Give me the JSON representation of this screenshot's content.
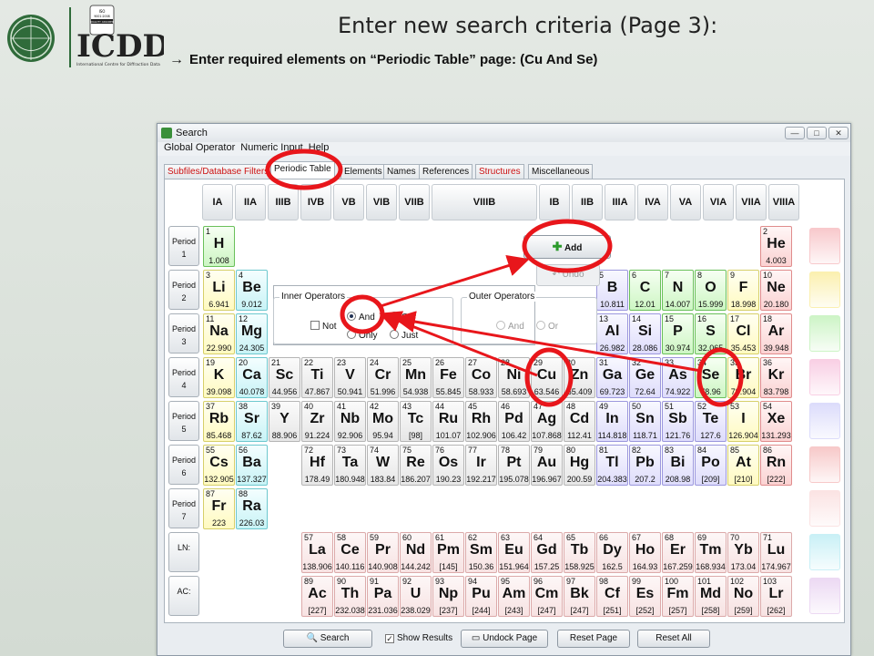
{
  "slide": {
    "title": "Enter new search criteria (Page 3):",
    "subtitle": "Enter required elements on “Periodic Table” page: (Cu And Se)",
    "bullet": "→",
    "logo_text": "ICDD",
    "logo_sub": "International Centre for Diffraction Data",
    "logo_badge": "ISO 9001:2008 QUALITY ASSURED COMPANY"
  },
  "window": {
    "title": "Search",
    "menu": [
      "Global Operator",
      "Numeric Input",
      "Help"
    ],
    "tabs": [
      {
        "label": "Subfiles/Database Filters",
        "red": true
      },
      {
        "label": "Periodic Table",
        "selected": true
      },
      {
        "label": "Elements"
      },
      {
        "label": "Names"
      },
      {
        "label": "References"
      },
      {
        "label": "Structures",
        "red": true
      },
      {
        "label": "Miscellaneous"
      }
    ]
  },
  "groups": [
    "IA",
    "IIA",
    "IIIB",
    "IVB",
    "VB",
    "VIB",
    "VIIB",
    "VIIIB",
    "IB",
    "IIB",
    "IIIA",
    "IVA",
    "VA",
    "VIA",
    "VIIA",
    "VIIIA"
  ],
  "periods": [
    {
      "l1": "Period",
      "l2": "1"
    },
    {
      "l1": "Period",
      "l2": "2"
    },
    {
      "l1": "Period",
      "l2": "3"
    },
    {
      "l1": "Period",
      "l2": "4"
    },
    {
      "l1": "Period",
      "l2": "5"
    },
    {
      "l1": "Period",
      "l2": "6"
    },
    {
      "l1": "Period",
      "l2": "7"
    },
    {
      "l1": "LN:",
      "l2": ""
    },
    {
      "l1": "AC:",
      "l2": ""
    }
  ],
  "controls": {
    "add": "Add",
    "undo": "Undo",
    "inner_ops": "Inner Operators",
    "outer_ops": "Outer Operators",
    "not": "Not",
    "and": "And",
    "or": "Or",
    "only": "Only",
    "just": "Just",
    "outer_and": "And",
    "outer_or": "Or"
  },
  "bottom": {
    "search": "Search",
    "show_results": "Show Results",
    "undock": "Undock Page",
    "reset_page": "Reset Page",
    "reset_all": "Reset All"
  },
  "elements": [
    {
      "n": 1,
      "s": "H",
      "w": "1.008",
      "c": "grn",
      "r": 0,
      "g": 0
    },
    {
      "n": 2,
      "s": "He",
      "w": "4.003",
      "c": "red",
      "r": 0,
      "g": 15
    },
    {
      "n": 3,
      "s": "Li",
      "w": "6.941",
      "c": "yel",
      "r": 1,
      "g": 0
    },
    {
      "n": 4,
      "s": "Be",
      "w": "9.012",
      "c": "cyan",
      "r": 1,
      "g": 1
    },
    {
      "n": 5,
      "s": "B",
      "w": "10.811",
      "c": "blu",
      "r": 1,
      "g": 10
    },
    {
      "n": 6,
      "s": "C",
      "w": "12.01",
      "c": "grn",
      "r": 1,
      "g": 11
    },
    {
      "n": 7,
      "s": "N",
      "w": "14.007",
      "c": "grn",
      "r": 1,
      "g": 12
    },
    {
      "n": 8,
      "s": "O",
      "w": "15.999",
      "c": "grn",
      "r": 1,
      "g": 13
    },
    {
      "n": 9,
      "s": "F",
      "w": "18.998",
      "c": "yel",
      "r": 1,
      "g": 14
    },
    {
      "n": 10,
      "s": "Ne",
      "w": "20.180",
      "c": "red",
      "r": 1,
      "g": 15
    },
    {
      "n": 11,
      "s": "Na",
      "w": "22.990",
      "c": "yel",
      "r": 2,
      "g": 0
    },
    {
      "n": 12,
      "s": "Mg",
      "w": "24.305",
      "c": "cyan",
      "r": 2,
      "g": 1
    },
    {
      "n": 13,
      "s": "Al",
      "w": "26.982",
      "c": "blu",
      "r": 2,
      "g": 10
    },
    {
      "n": 14,
      "s": "Si",
      "w": "28.086",
      "c": "blu",
      "r": 2,
      "g": 11
    },
    {
      "n": 15,
      "s": "P",
      "w": "30.974",
      "c": "grn",
      "r": 2,
      "g": 12
    },
    {
      "n": 16,
      "s": "S",
      "w": "32.065",
      "c": "grn",
      "r": 2,
      "g": 13
    },
    {
      "n": 17,
      "s": "Cl",
      "w": "35.453",
      "c": "yel",
      "r": 2,
      "g": 14
    },
    {
      "n": 18,
      "s": "Ar",
      "w": "39.948",
      "c": "red",
      "r": 2,
      "g": 15
    },
    {
      "n": 19,
      "s": "K",
      "w": "39.098",
      "c": "yel",
      "r": 3,
      "g": 0
    },
    {
      "n": 20,
      "s": "Ca",
      "w": "40.078",
      "c": "cyan",
      "r": 3,
      "g": 1
    },
    {
      "n": 21,
      "s": "Sc",
      "w": "44.956",
      "c": "gry",
      "r": 3,
      "g": 2
    },
    {
      "n": 22,
      "s": "Ti",
      "w": "47.867",
      "c": "gry",
      "r": 3,
      "g": 3
    },
    {
      "n": 23,
      "s": "V",
      "w": "50.941",
      "c": "gry",
      "r": 3,
      "g": 4
    },
    {
      "n": 24,
      "s": "Cr",
      "w": "51.996",
      "c": "gry",
      "r": 3,
      "g": 5
    },
    {
      "n": 25,
      "s": "Mn",
      "w": "54.938",
      "c": "gry",
      "r": 3,
      "g": 6
    },
    {
      "n": 26,
      "s": "Fe",
      "w": "55.845",
      "c": "gry",
      "r": 3,
      "g": 7
    },
    {
      "n": 27,
      "s": "Co",
      "w": "58.933",
      "c": "gry",
      "r": 3,
      "g": 8
    },
    {
      "n": 28,
      "s": "Ni",
      "w": "58.693",
      "c": "gry",
      "r": 3,
      "g": 9
    },
    {
      "n": 29,
      "s": "Cu",
      "w": "63.546",
      "c": "gry",
      "r": 3,
      "g": 10
    },
    {
      "n": 30,
      "s": "Zn",
      "w": "65.409",
      "c": "gry",
      "r": 3,
      "g": 11
    },
    {
      "n": 31,
      "s": "Ga",
      "w": "69.723",
      "c": "blu",
      "r": 3,
      "g": 12
    },
    {
      "n": 32,
      "s": "Ge",
      "w": "72.64",
      "c": "blu",
      "r": 3,
      "g": 13
    },
    {
      "n": 33,
      "s": "As",
      "w": "74.922",
      "c": "blu",
      "r": 3,
      "g": 14
    },
    {
      "n": 34,
      "s": "Se",
      "w": "78.96",
      "c": "grn",
      "r": 3,
      "g": 15
    },
    {
      "n": 35,
      "s": "Br",
      "w": "79.904",
      "c": "yel",
      "r": 3,
      "g": 16
    },
    {
      "n": 36,
      "s": "Kr",
      "w": "83.798",
      "c": "red",
      "r": 3,
      "g": 17
    },
    {
      "n": 37,
      "s": "Rb",
      "w": "85.468",
      "c": "yel",
      "r": 4,
      "g": 0
    },
    {
      "n": 38,
      "s": "Sr",
      "w": "87.62",
      "c": "cyan",
      "r": 4,
      "g": 1
    },
    {
      "n": 39,
      "s": "Y",
      "w": "88.906",
      "c": "gry",
      "r": 4,
      "g": 2
    },
    {
      "n": 40,
      "s": "Zr",
      "w": "91.224",
      "c": "gry",
      "r": 4,
      "g": 3
    },
    {
      "n": 41,
      "s": "Nb",
      "w": "92.906",
      "c": "gry",
      "r": 4,
      "g": 4
    },
    {
      "n": 42,
      "s": "Mo",
      "w": "95.94",
      "c": "gry",
      "r": 4,
      "g": 5
    },
    {
      "n": 43,
      "s": "Tc",
      "w": "[98]",
      "c": "gry",
      "r": 4,
      "g": 6
    },
    {
      "n": 44,
      "s": "Ru",
      "w": "101.07",
      "c": "gry",
      "r": 4,
      "g": 7
    },
    {
      "n": 45,
      "s": "Rh",
      "w": "102.906",
      "c": "gry",
      "r": 4,
      "g": 8
    },
    {
      "n": 46,
      "s": "Pd",
      "w": "106.42",
      "c": "gry",
      "r": 4,
      "g": 9
    },
    {
      "n": 47,
      "s": "Ag",
      "w": "107.868",
      "c": "gry",
      "r": 4,
      "g": 10
    },
    {
      "n": 48,
      "s": "Cd",
      "w": "112.41",
      "c": "gry",
      "r": 4,
      "g": 11
    },
    {
      "n": 49,
      "s": "In",
      "w": "114.818",
      "c": "blu",
      "r": 4,
      "g": 12
    },
    {
      "n": 50,
      "s": "Sn",
      "w": "118.71",
      "c": "blu",
      "r": 4,
      "g": 13
    },
    {
      "n": 51,
      "s": "Sb",
      "w": "121.76",
      "c": "blu",
      "r": 4,
      "g": 14
    },
    {
      "n": 52,
      "s": "Te",
      "w": "127.6",
      "c": "blu",
      "r": 4,
      "g": 15
    },
    {
      "n": 53,
      "s": "I",
      "w": "126.904",
      "c": "yel",
      "r": 4,
      "g": 16
    },
    {
      "n": 54,
      "s": "Xe",
      "w": "131.293",
      "c": "red",
      "r": 4,
      "g": 17
    },
    {
      "n": 55,
      "s": "Cs",
      "w": "132.905",
      "c": "yel",
      "r": 5,
      "g": 0
    },
    {
      "n": 56,
      "s": "Ba",
      "w": "137.327",
      "c": "cyan",
      "r": 5,
      "g": 1
    },
    {
      "n": 72,
      "s": "Hf",
      "w": "178.49",
      "c": "gry",
      "r": 5,
      "g": 3
    },
    {
      "n": 73,
      "s": "Ta",
      "w": "180.948",
      "c": "gry",
      "r": 5,
      "g": 4
    },
    {
      "n": 74,
      "s": "W",
      "w": "183.84",
      "c": "gry",
      "r": 5,
      "g": 5
    },
    {
      "n": 75,
      "s": "Re",
      "w": "186.207",
      "c": "gry",
      "r": 5,
      "g": 6
    },
    {
      "n": 76,
      "s": "Os",
      "w": "190.23",
      "c": "gry",
      "r": 5,
      "g": 7
    },
    {
      "n": 77,
      "s": "Ir",
      "w": "192.217",
      "c": "gry",
      "r": 5,
      "g": 8
    },
    {
      "n": 78,
      "s": "Pt",
      "w": "195.078",
      "c": "gry",
      "r": 5,
      "g": 9
    },
    {
      "n": 79,
      "s": "Au",
      "w": "196.967",
      "c": "gry",
      "r": 5,
      "g": 10
    },
    {
      "n": 80,
      "s": "Hg",
      "w": "200.59",
      "c": "gry",
      "r": 5,
      "g": 11
    },
    {
      "n": 81,
      "s": "Tl",
      "w": "204.383",
      "c": "blu",
      "r": 5,
      "g": 12
    },
    {
      "n": 82,
      "s": "Pb",
      "w": "207.2",
      "c": "blu",
      "r": 5,
      "g": 13
    },
    {
      "n": 83,
      "s": "Bi",
      "w": "208.98",
      "c": "blu",
      "r": 5,
      "g": 14
    },
    {
      "n": 84,
      "s": "Po",
      "w": "[209]",
      "c": "blu",
      "r": 5,
      "g": 15
    },
    {
      "n": 85,
      "s": "At",
      "w": "[210]",
      "c": "yel",
      "r": 5,
      "g": 16
    },
    {
      "n": 86,
      "s": "Rn",
      "w": "[222]",
      "c": "red",
      "r": 5,
      "g": 17
    },
    {
      "n": 87,
      "s": "Fr",
      "w": "223",
      "c": "yel",
      "r": 6,
      "g": 0
    },
    {
      "n": 88,
      "s": "Ra",
      "w": "226.03",
      "c": "cyan",
      "r": 6,
      "g": 1
    },
    {
      "n": 57,
      "s": "La",
      "w": "138.906",
      "c": "ln",
      "r": 7,
      "g": 3
    },
    {
      "n": 58,
      "s": "Ce",
      "w": "140.116",
      "c": "ln",
      "r": 7,
      "g": 4
    },
    {
      "n": 59,
      "s": "Pr",
      "w": "140.908",
      "c": "ln",
      "r": 7,
      "g": 5
    },
    {
      "n": 60,
      "s": "Nd",
      "w": "144.242",
      "c": "ln",
      "r": 7,
      "g": 6
    },
    {
      "n": 61,
      "s": "Pm",
      "w": "[145]",
      "c": "ln",
      "r": 7,
      "g": 7
    },
    {
      "n": 62,
      "s": "Sm",
      "w": "150.36",
      "c": "ln",
      "r": 7,
      "g": 8
    },
    {
      "n": 63,
      "s": "Eu",
      "w": "151.964",
      "c": "ln",
      "r": 7,
      "g": 9
    },
    {
      "n": 64,
      "s": "Gd",
      "w": "157.25",
      "c": "ln",
      "r": 7,
      "g": 10
    },
    {
      "n": 65,
      "s": "Tb",
      "w": "158.925",
      "c": "ln",
      "r": 7,
      "g": 11
    },
    {
      "n": 66,
      "s": "Dy",
      "w": "162.5",
      "c": "ln",
      "r": 7,
      "g": 12
    },
    {
      "n": 67,
      "s": "Ho",
      "w": "164.93",
      "c": "ln",
      "r": 7,
      "g": 13
    },
    {
      "n": 68,
      "s": "Er",
      "w": "167.259",
      "c": "ln",
      "r": 7,
      "g": 14
    },
    {
      "n": 69,
      "s": "Tm",
      "w": "168.934",
      "c": "ln",
      "r": 7,
      "g": 15
    },
    {
      "n": 70,
      "s": "Yb",
      "w": "173.04",
      "c": "ln",
      "r": 7,
      "g": 16
    },
    {
      "n": 71,
      "s": "Lu",
      "w": "174.967",
      "c": "ln",
      "r": 7,
      "g": 17
    },
    {
      "n": 89,
      "s": "Ac",
      "w": "[227]",
      "c": "ln",
      "r": 8,
      "g": 3
    },
    {
      "n": 90,
      "s": "Th",
      "w": "232.038",
      "c": "ln",
      "r": 8,
      "g": 4
    },
    {
      "n": 91,
      "s": "Pa",
      "w": "231.036",
      "c": "ln",
      "r": 8,
      "g": 5
    },
    {
      "n": 92,
      "s": "U",
      "w": "238.029",
      "c": "ln",
      "r": 8,
      "g": 6
    },
    {
      "n": 93,
      "s": "Np",
      "w": "[237]",
      "c": "ln",
      "r": 8,
      "g": 7
    },
    {
      "n": 94,
      "s": "Pu",
      "w": "[244]",
      "c": "ln",
      "r": 8,
      "g": 8
    },
    {
      "n": 95,
      "s": "Am",
      "w": "[243]",
      "c": "ln",
      "r": 8,
      "g": 9
    },
    {
      "n": 96,
      "s": "Cm",
      "w": "[247]",
      "c": "ln",
      "r": 8,
      "g": 10
    },
    {
      "n": 97,
      "s": "Bk",
      "w": "[247]",
      "c": "ln",
      "r": 8,
      "g": 11
    },
    {
      "n": 98,
      "s": "Cf",
      "w": "[251]",
      "c": "ln",
      "r": 8,
      "g": 12
    },
    {
      "n": 99,
      "s": "Es",
      "w": "[252]",
      "c": "ln",
      "r": 8,
      "g": 13
    },
    {
      "n": 100,
      "s": "Fm",
      "w": "[257]",
      "c": "ln",
      "r": 8,
      "g": 14
    },
    {
      "n": 101,
      "s": "Md",
      "w": "[258]",
      "c": "ln",
      "r": 8,
      "g": 15
    },
    {
      "n": 102,
      "s": "No",
      "w": "[259]",
      "c": "ln",
      "r": 8,
      "g": 16
    },
    {
      "n": 103,
      "s": "Lr",
      "w": "[262]",
      "c": "ln",
      "r": 8,
      "g": 17
    }
  ],
  "side_bars": [
    "#f8c9cc",
    "#fbf0b0",
    "#cdf4c6",
    "#f9cfe4",
    "#dcdcfb",
    "#f7c9c9",
    "#fbe3e3",
    "#c9f0f6",
    "#ecd9f3"
  ],
  "annotation_color": "#e8161b"
}
